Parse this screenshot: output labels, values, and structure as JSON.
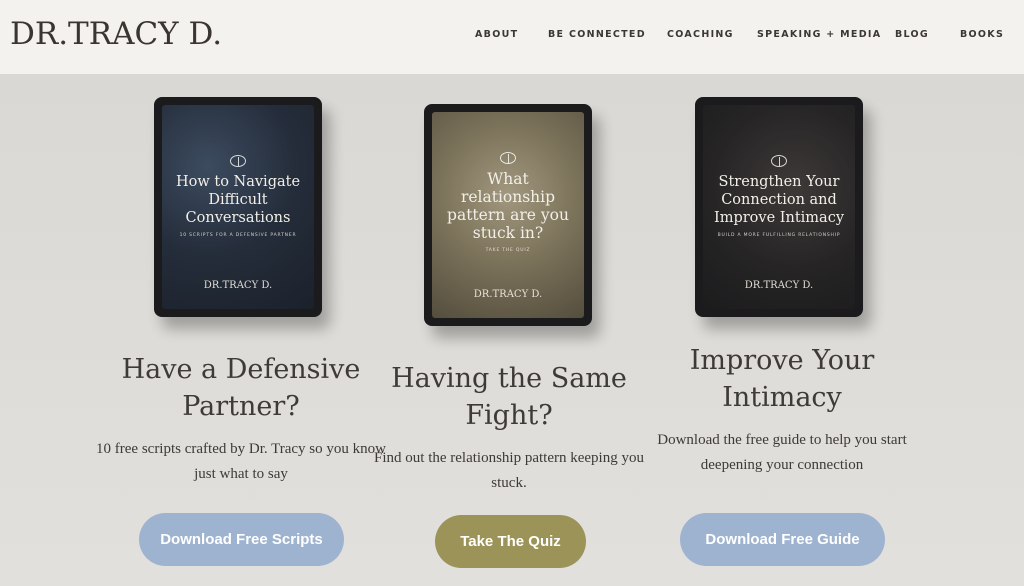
{
  "header": {
    "logo": "DR.TRACY D.",
    "nav": [
      "ABOUT",
      "BE CONNECTED",
      "COACHING",
      "SPEAKING + MEDIA",
      "BLOG",
      "BOOKS"
    ]
  },
  "cards": [
    {
      "ebook_title": "How to Navigate Difficult Conversations",
      "ebook_subtitle": "10 Scripts for a Defensive Partner",
      "ebook_brand": "DR.TRACY D.",
      "heading": "Have a Defensive Partner?",
      "description": "10 free scripts crafted by Dr. Tracy so you know just what to say",
      "button": "Download Free Scripts"
    },
    {
      "ebook_title": "What relationship pattern are you stuck in?",
      "ebook_subtitle": "Take the Quiz",
      "ebook_brand": "DR.TRACY D.",
      "heading": "Having the Same Fight?",
      "description": "Find out the relationship pattern keeping you stuck.",
      "button": "Take The Quiz"
    },
    {
      "ebook_title": "Strengthen Your Connection and Improve Intimacy",
      "ebook_subtitle": "Build a More Fulfilling Relationship",
      "ebook_brand": "DR.TRACY D.",
      "heading": "Improve Your Intimacy",
      "description": "Download the free guide to help you start deepening your connection",
      "button": "Download Free Guide"
    }
  ],
  "colors": {
    "header_bg": "#f4f2ef",
    "page_bg": "#dedcd8",
    "button_blue": "#9eb3d0",
    "button_olive": "#9b9357"
  }
}
